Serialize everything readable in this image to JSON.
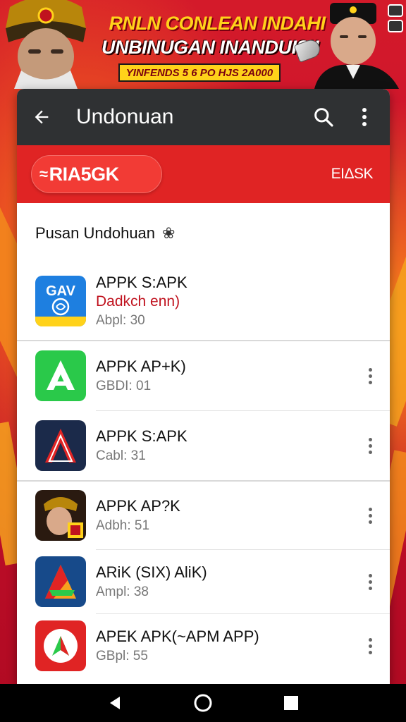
{
  "banner": {
    "line1": "RNLN CONLEAN INDAHI",
    "line2": "UNBINUGAN INANDUISII",
    "strip": "YINFENDS 5 6 PO HJS 2A000"
  },
  "appbar": {
    "title": "Undonuan",
    "back_icon": "arrow-left-icon",
    "search_icon": "search-icon",
    "more_icon": "more-vert-icon"
  },
  "redbar": {
    "pill_label": "RIA5GK",
    "right_label": "EIΔSK"
  },
  "section": {
    "title": "Pusan Undohuan"
  },
  "apps": [
    {
      "name": "APPK S:APK",
      "sub": "Dadkch enn)",
      "meta": "Abpl: 30",
      "icon_text": "GAV"
    },
    {
      "name": "APPK AP+K)",
      "meta": "GBDI: 01"
    },
    {
      "name": "APPK S:APK",
      "meta": "Cabl: 31"
    },
    {
      "name": "APPK AP?K",
      "meta": "Adbh: 51"
    },
    {
      "name": "ARiK (SIX) AliK)",
      "meta": "Ampl: 38"
    },
    {
      "name": "APEK APK(~APM APP)",
      "meta": "GBpl: 55"
    }
  ],
  "colors": {
    "appbar": "#2f3133",
    "redbar": "#e02424",
    "accent_text": "#c0121e"
  }
}
